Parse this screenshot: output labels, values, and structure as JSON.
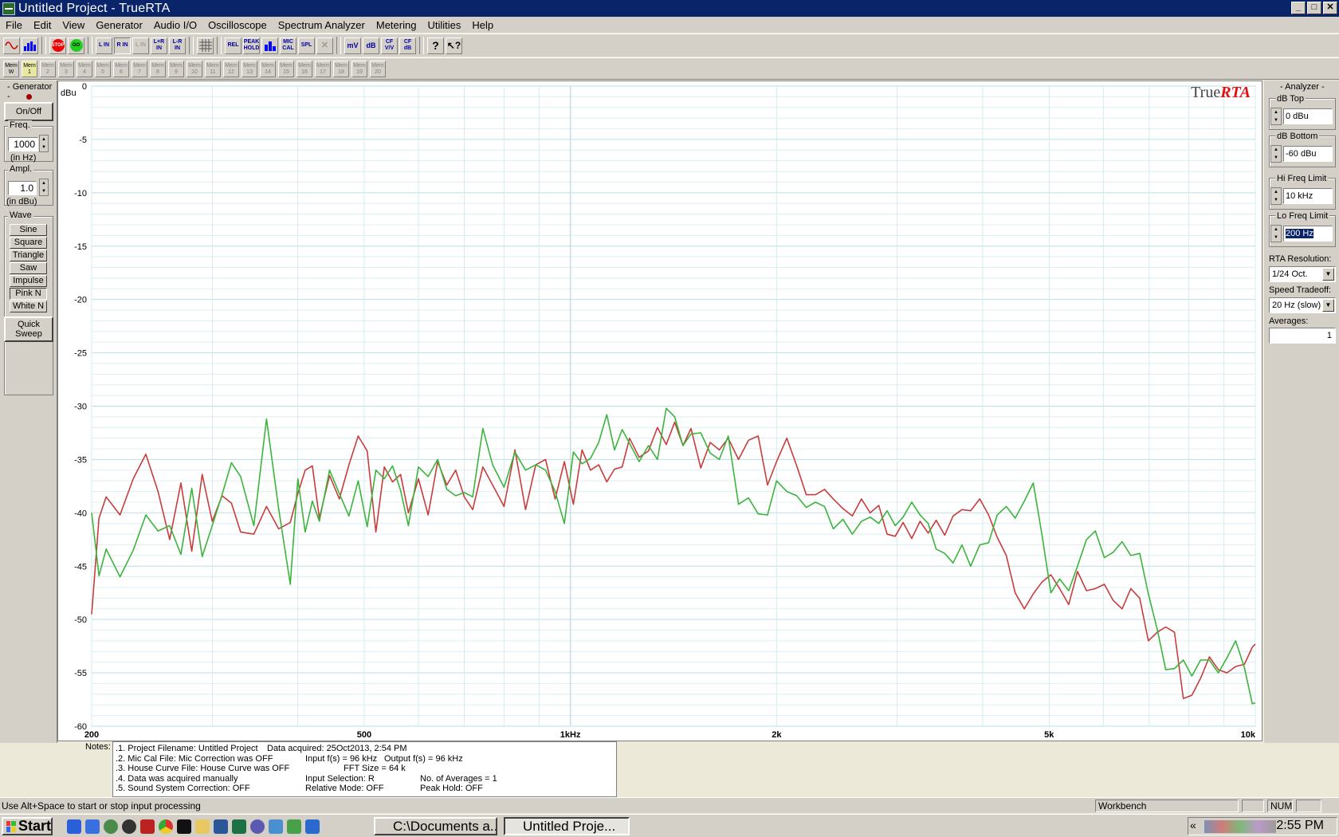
{
  "window": {
    "title": "Untitled Project - TrueRTA"
  },
  "menu": [
    "File",
    "Edit",
    "View",
    "Generator",
    "Audio I/O",
    "Oscilloscope",
    "Spectrum Analyzer",
    "Metering",
    "Utilities",
    "Help"
  ],
  "toolbar1": {
    "group1": [
      "sine-wave",
      "rta-bars"
    ],
    "group2": [
      "STOP",
      "GO"
    ],
    "group3": [
      "L IN",
      "R IN",
      "L IN",
      "L+R IN",
      "L-R IN"
    ],
    "group4": [
      "grid"
    ],
    "group5": [
      "REL",
      "PEAK HOLD",
      "bars",
      "MIC CAL",
      "SPL",
      "x"
    ],
    "group6": [
      "mV",
      "dB",
      "CF V/V",
      "CF dB"
    ],
    "group7": [
      "?",
      "?"
    ]
  },
  "toolbar2": {
    "mem_buttons": [
      "Mem W",
      "Mem 1",
      "Mem 2",
      "Mem 3",
      "Mem 4",
      "Mem 5",
      "Mem 6",
      "Mem 7",
      "Mem 8",
      "Mem 9",
      "Mem 10",
      "Mem 11",
      "Mem 12",
      "Mem 13",
      "Mem 14",
      "Mem 15",
      "Mem 16",
      "Mem 17",
      "Mem 18",
      "Mem 19",
      "Mem 20"
    ]
  },
  "generator": {
    "title": "Generator",
    "onoff": "On/Off",
    "freq_label": "Freq.",
    "freq_value": "1000",
    "freq_unit": "(in Hz)",
    "ampl_label": "Ampl.",
    "ampl_value": "1.0",
    "ampl_unit": "(in dBu)",
    "wave_label": "Wave",
    "waves": [
      "Sine",
      "Square",
      "Triangle",
      "Saw",
      "Impulse",
      "Pink N",
      "White N"
    ],
    "quick_sweep": "Quick Sweep"
  },
  "analyzer": {
    "title": "Analyzer",
    "db_top_label": "dB Top",
    "db_top_value": "0 dBu",
    "db_bottom_label": "dB Bottom",
    "db_bottom_value": "-60 dBu",
    "hi_freq_label": "Hi Freq Limit",
    "hi_freq_value": "10 kHz",
    "lo_freq_label": "Lo Freq Limit",
    "lo_freq_value": "200 Hz",
    "rta_res_label": "RTA Resolution:",
    "rta_res_value": "1/24 Oct.",
    "speed_label": "Speed Tradeoff:",
    "speed_value": "20 Hz (slow)",
    "averages_label": "Averages:",
    "averages_value": "1"
  },
  "chart_data": {
    "type": "line",
    "ylabel": "dBu",
    "logo": "TrueRTA",
    "x_scale": "log",
    "xlim": [
      200,
      10000
    ],
    "ylim": [
      -60,
      0
    ],
    "x_tick_labels": [
      {
        "value": 200,
        "label": "200"
      },
      {
        "value": 500,
        "label": "500"
      },
      {
        "value": 1000,
        "label": "1kHz"
      },
      {
        "value": 2000,
        "label": "2k"
      },
      {
        "value": 5000,
        "label": "5k"
      },
      {
        "value": 10000,
        "label": "10k"
      }
    ],
    "y_tick_labels": [
      "0",
      "-5",
      "-10",
      "-15",
      "-20",
      "-25",
      "-30",
      "-35",
      "-40",
      "-45",
      "-50",
      "-55",
      "-60"
    ],
    "grid": true,
    "series": [
      {
        "color": "#c83c3c",
        "x": [
          200,
          205,
          210,
          220,
          230,
          240,
          250,
          260,
          270,
          280,
          290,
          300,
          310,
          320,
          330,
          345,
          360,
          375,
          390,
          400,
          410,
          420,
          430,
          445,
          460,
          475,
          490,
          505,
          520,
          535,
          550,
          565,
          580,
          600,
          620,
          640,
          660,
          680,
          700,
          720,
          745,
          770,
          800,
          830,
          860,
          890,
          920,
          950,
          980,
          1010,
          1040,
          1070,
          1100,
          1130,
          1160,
          1190,
          1220,
          1260,
          1300,
          1340,
          1380,
          1420,
          1460,
          1500,
          1550,
          1600,
          1650,
          1700,
          1760,
          1820,
          1880,
          1940,
          2000,
          2070,
          2140,
          2210,
          2280,
          2350,
          2420,
          2500,
          2580,
          2660,
          2740,
          2820,
          2900,
          2980,
          3060,
          3150,
          3240,
          3330,
          3420,
          3520,
          3620,
          3730,
          3840,
          3960,
          4080,
          4200,
          4330,
          4460,
          4600,
          4740,
          4880,
          5030,
          5180,
          5340,
          5500,
          5670,
          5840,
          6020,
          6200,
          6390,
          6580,
          6780,
          6980,
          7190,
          7400,
          7620,
          7850,
          8080,
          8320,
          8570,
          8830,
          9090,
          9360,
          9640,
          9900,
          10000
        ],
        "y": [
          -49.5,
          -40.5,
          -38.5,
          -40.2,
          -36.8,
          -34.5,
          -38.0,
          -42.5,
          -37.2,
          -43.6,
          -36.4,
          -40.8,
          -38.4,
          -39.1,
          -41.8,
          -42.0,
          -39.4,
          -41.5,
          -40.9,
          -38.2,
          -36.0,
          -35.6,
          -40.5,
          -36.5,
          -38.7,
          -35.5,
          -32.8,
          -34.2,
          -41.8,
          -35.7,
          -37.1,
          -36.4,
          -40.0,
          -36.8,
          -40.2,
          -35.2,
          -37.4,
          -36.0,
          -38.5,
          -39.7,
          -35.7,
          -37.4,
          -39.4,
          -34.1,
          -39.7,
          -35.5,
          -35.0,
          -38.7,
          -35.2,
          -39.2,
          -34.1,
          -36.0,
          -35.5,
          -37.1,
          -35.9,
          -35.7,
          -33.0,
          -34.8,
          -34.2,
          -32.0,
          -33.6,
          -31.5,
          -33.7,
          -32.1,
          -35.8,
          -33.4,
          -34.1,
          -33.0,
          -35.0,
          -33.2,
          -32.8,
          -37.4,
          -35.2,
          -33.0,
          -35.6,
          -38.3,
          -38.3,
          -37.8,
          -38.7,
          -39.6,
          -40.3,
          -38.7,
          -40.0,
          -39.3,
          -42.0,
          -42.2,
          -40.9,
          -42.4,
          -40.8,
          -41.9,
          -40.7,
          -42.1,
          -40.3,
          -39.7,
          -39.8,
          -38.7,
          -40.2,
          -42.3,
          -44.0,
          -47.5,
          -49.0,
          -47.6,
          -46.5,
          -45.8,
          -47.1,
          -48.6,
          -45.5,
          -47.3,
          -47.1,
          -46.7,
          -48.2,
          -49.0,
          -47.1,
          -48.0,
          -52.0,
          -51.2,
          -50.7,
          -51.2,
          -57.4,
          -57.1,
          -55.5,
          -53.5,
          -54.7,
          -55.0,
          -54.4,
          -54.2,
          -52.6,
          -52.3
        ]
      },
      {
        "color": "#3cb43c",
        "x": [
          200,
          205,
          210,
          220,
          230,
          240,
          250,
          260,
          270,
          280,
          290,
          300,
          310,
          320,
          330,
          345,
          360,
          375,
          390,
          400,
          410,
          420,
          430,
          445,
          460,
          475,
          490,
          505,
          520,
          535,
          550,
          565,
          580,
          600,
          620,
          640,
          660,
          680,
          700,
          720,
          745,
          770,
          800,
          830,
          860,
          890,
          920,
          950,
          980,
          1010,
          1040,
          1070,
          1100,
          1130,
          1160,
          1190,
          1220,
          1260,
          1300,
          1340,
          1380,
          1420,
          1460,
          1500,
          1550,
          1600,
          1650,
          1700,
          1760,
          1820,
          1880,
          1940,
          2000,
          2070,
          2140,
          2210,
          2280,
          2350,
          2420,
          2500,
          2580,
          2660,
          2740,
          2820,
          2900,
          2980,
          3060,
          3150,
          3240,
          3330,
          3420,
          3520,
          3620,
          3730,
          3840,
          3960,
          4080,
          4200,
          4330,
          4460,
          4600,
          4740,
          4880,
          5030,
          5180,
          5340,
          5500,
          5670,
          5840,
          6020,
          6200,
          6390,
          6580,
          6780,
          6980,
          7190,
          7400,
          7620,
          7850,
          8080,
          8320,
          8570,
          8830,
          9090,
          9360,
          9640,
          9900,
          10000
        ],
        "y": [
          -40.0,
          -45.9,
          -43.4,
          -46.0,
          -43.5,
          -40.2,
          -41.7,
          -41.2,
          -43.9,
          -37.7,
          -44.1,
          -41.2,
          -38.3,
          -35.3,
          -36.6,
          -41.2,
          -31.2,
          -39.6,
          -46.7,
          -36.8,
          -41.8,
          -38.9,
          -40.8,
          -36.0,
          -38.2,
          -40.3,
          -37.0,
          -41.3,
          -36.0,
          -36.8,
          -35.6,
          -37.9,
          -41.2,
          -35.7,
          -36.6,
          -35.0,
          -37.8,
          -38.4,
          -38.1,
          -38.5,
          -32.1,
          -35.5,
          -37.6,
          -34.3,
          -36.0,
          -35.5,
          -36.0,
          -38.0,
          -41.0,
          -34.3,
          -35.4,
          -34.9,
          -33.4,
          -30.8,
          -34.1,
          -32.2,
          -33.5,
          -35.2,
          -33.7,
          -35.0,
          -30.2,
          -31.0,
          -33.7,
          -32.6,
          -32.5,
          -34.4,
          -35.0,
          -32.8,
          -39.2,
          -38.6,
          -40.1,
          -40.2,
          -37.0,
          -38.0,
          -38.4,
          -39.5,
          -39.0,
          -39.4,
          -41.5,
          -40.6,
          -42.0,
          -40.8,
          -40.4,
          -41.0,
          -39.8,
          -41.2,
          -40.4,
          -39.0,
          -40.2,
          -41.0,
          -43.4,
          -43.8,
          -44.7,
          -43.0,
          -45.0,
          -43.0,
          -42.8,
          -40.2,
          -39.4,
          -40.5,
          -38.9,
          -37.2,
          -42.0,
          -47.5,
          -46.2,
          -47.3,
          -45.0,
          -42.5,
          -41.7,
          -44.2,
          -43.7,
          -42.7,
          -44.0,
          -43.8,
          -47.6,
          -50.9,
          -54.7,
          -54.6,
          -53.8,
          -55.3,
          -53.8,
          -53.8,
          -55.0,
          -53.6,
          -52.0,
          -54.5,
          -57.9,
          -57.8
        ]
      }
    ]
  },
  "notes": {
    "label": "Notes:",
    "lines": [
      {
        "c1": ".1. Project Filename: Untitled Project",
        "c2": "Data acquired: 25Oct2013, 2:54 PM",
        "c3": ""
      },
      {
        "c1": ".2. Mic Cal File: Mic Correction was OFF",
        "c2": "Input f(s) = 96 kHz",
        "c3": "Output f(s) = 96 kHz"
      },
      {
        "c1": ".3. House Curve File: House Curve was OFF",
        "c2": "FFT Size = 64 k",
        "c3": ""
      },
      {
        "c1": ".4. Data was acquired manually",
        "c2": "Input Selection: R",
        "c3": "No. of Averages = 1"
      },
      {
        "c1": ".5. Sound System Correction: OFF",
        "c2": "Relative Mode:  OFF",
        "c3": "Peak Hold: OFF"
      }
    ]
  },
  "status": {
    "message": "Use Alt+Space to start or stop input processing",
    "workbench": "Workbench",
    "num": "NUM"
  },
  "taskbar": {
    "start": "Start",
    "tasks": [
      "C:\\Documents a...",
      "Untitled Proje..."
    ],
    "clock": "2:55 PM"
  }
}
